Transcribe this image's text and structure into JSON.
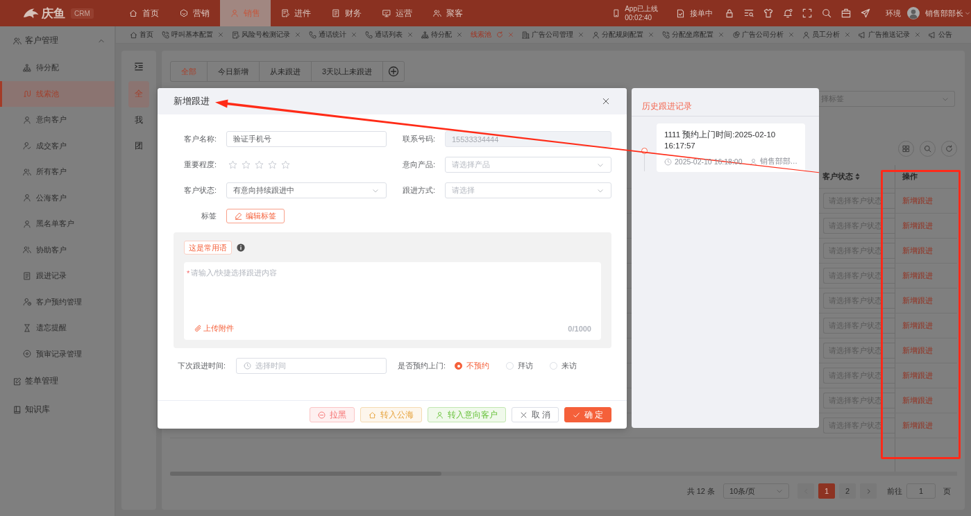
{
  "top_bar": {
    "logo": {
      "text": "庆鱼",
      "badge": "CRM"
    },
    "nav": [
      {
        "label": "首页",
        "selected": false
      },
      {
        "label": "营销",
        "selected": false
      },
      {
        "label": "销售",
        "selected": true
      },
      {
        "label": "进件",
        "selected": false
      },
      {
        "label": "财务",
        "selected": false
      },
      {
        "label": "运营",
        "selected": false
      },
      {
        "label": "聚客",
        "selected": false
      }
    ],
    "app_status": {
      "label": "App已上线",
      "time": "00:02:40"
    },
    "order_status": "接单中",
    "environment": "环境",
    "user": "销售部部长"
  },
  "page_tabs": [
    {
      "label": "首页",
      "selected": false,
      "closable": false
    },
    {
      "label": "呼叫基本配置",
      "selected": false,
      "closable": true
    },
    {
      "label": "风险号检测记录",
      "selected": false,
      "closable": true
    },
    {
      "label": "通话统计",
      "selected": false,
      "closable": true
    },
    {
      "label": "通话列表",
      "selected": false,
      "closable": true
    },
    {
      "label": "待分配",
      "selected": false,
      "closable": true
    },
    {
      "label": "线索池",
      "selected": true,
      "closable": true
    },
    {
      "label": "广告公司管理",
      "selected": false,
      "closable": true
    },
    {
      "label": "分配规则配置",
      "selected": false,
      "closable": true
    },
    {
      "label": "分配坐席配置",
      "selected": false,
      "closable": true
    },
    {
      "label": "广告公司分析",
      "selected": false,
      "closable": true
    },
    {
      "label": "员工分析",
      "selected": false,
      "closable": true
    },
    {
      "label": "广告推送记录",
      "selected": false,
      "closable": true
    },
    {
      "label": "公告",
      "selected": false,
      "closable": false
    }
  ],
  "sidebar": [
    {
      "kind": "group",
      "label": "客户管理",
      "expanded": true,
      "children": [
        {
          "label": "待分配",
          "selected": false
        },
        {
          "label": "线索池",
          "selected": true
        },
        {
          "label": "意向客户",
          "selected": false
        },
        {
          "label": "成交客户",
          "selected": false
        },
        {
          "label": "所有客户",
          "selected": false
        },
        {
          "label": "公海客户",
          "selected": false
        },
        {
          "label": "黑名单客户",
          "selected": false
        },
        {
          "label": "协助客户",
          "selected": false
        },
        {
          "label": "跟进记录",
          "selected": false
        },
        {
          "label": "客户预约管理",
          "selected": false
        },
        {
          "label": "遗忘提醒",
          "selected": false
        },
        {
          "label": "预审记录管理",
          "selected": false
        }
      ]
    },
    {
      "kind": "link",
      "label": "签单管理",
      "selected": false
    },
    {
      "kind": "link",
      "label": "知识库",
      "selected": false
    }
  ],
  "scope_tabs": [
    {
      "label": "全",
      "selected": true
    },
    {
      "label": "我",
      "selected": false
    },
    {
      "label": "团",
      "selected": false
    }
  ],
  "filter_tabs": [
    {
      "label": "全部",
      "selected": true
    },
    {
      "label": "今日新增",
      "selected": false
    },
    {
      "label": "从未跟进",
      "selected": false
    },
    {
      "label": "3天以上未跟进",
      "selected": false
    }
  ],
  "tag_filter": {
    "placeholder": "择标签"
  },
  "table": {
    "columns": [
      {
        "label": "客户状态",
        "sortable": true
      },
      {
        "label": "操作",
        "sortable": false
      }
    ],
    "rows": [
      {
        "status_placeholder": "请选择客户状态",
        "action": "新增跟进"
      },
      {
        "status_placeholder": "请选择客户状态",
        "action": "新增跟进"
      },
      {
        "status_placeholder": "请选择客户状态",
        "action": "新增跟进"
      },
      {
        "status_placeholder": "请选择客户状态",
        "action": "新增跟进"
      },
      {
        "status_placeholder": "请选择客户状态",
        "action": "新增跟进"
      },
      {
        "status_placeholder": "请选择客户状态",
        "action": "新增跟进"
      },
      {
        "status_placeholder": "请选择客户状态",
        "action": "新增跟进"
      },
      {
        "status_placeholder": "请选择客户状态",
        "action": "新增跟进"
      },
      {
        "status_placeholder": "请选择客户状态",
        "action": "新增跟进"
      },
      {
        "status_placeholder": "请选择客户状态",
        "action": "新增跟进"
      }
    ]
  },
  "pagination": {
    "total": "共 12 条",
    "page_size": "10条/页",
    "prev": {
      "disabled": true
    },
    "pages": [
      {
        "label": "1",
        "selected": true
      },
      {
        "label": "2",
        "selected": false
      }
    ],
    "next": {
      "disabled": false
    },
    "goto": {
      "label": "前往",
      "value": "1",
      "suffix": "页"
    }
  },
  "dialog": {
    "title": "新增跟进",
    "fields": [
      {
        "kind": "input",
        "label": "客户名称:",
        "value": "验证手机号",
        "disabled": false
      },
      {
        "kind": "input",
        "label": "联系号码:",
        "value": "15533334444",
        "disabled": true
      },
      {
        "kind": "stars",
        "label": "重要程度:",
        "stars": 0,
        "disabled": false
      },
      {
        "kind": "select",
        "label": "意向产品:",
        "placeholder": "请选择产品",
        "disabled": false
      },
      {
        "kind": "select",
        "label": "客户状态:",
        "value": "有意向持续跟进中",
        "disabled": false
      },
      {
        "kind": "select",
        "label": "跟进方式:",
        "placeholder": "请选择",
        "disabled": false
      }
    ],
    "tags": {
      "label": "标签",
      "button": "编辑标签"
    },
    "content": {
      "phrase_tag": "这是常用语",
      "required_mark": "*",
      "placeholder": "请输入/快捷选择跟进内容",
      "upload": "上传附件",
      "counter": "0/1000"
    },
    "next_time": {
      "label": "下次跟进时间:",
      "placeholder": "选择时间"
    },
    "visit": {
      "label": "是否预约上门:",
      "options": [
        {
          "label": "不预约",
          "selected": true
        },
        {
          "label": "拜访",
          "selected": false
        },
        {
          "label": "来访",
          "selected": false
        }
      ]
    },
    "buttons": [
      {
        "kind": "danger",
        "label": "拉黑"
      },
      {
        "kind": "warning",
        "label": "转入公海"
      },
      {
        "kind": "success",
        "label": "转入意向客户"
      },
      {
        "kind": "plain",
        "label": "取 消"
      },
      {
        "kind": "primary",
        "label": "确 定"
      }
    ]
  },
  "history": {
    "title": "历史跟进记录",
    "records": [
      {
        "text": "1111 预约上门时间:2025-02-10 16:17:57",
        "time": "2025-02-10 16:18:00",
        "author": "销售部部…"
      }
    ]
  }
}
